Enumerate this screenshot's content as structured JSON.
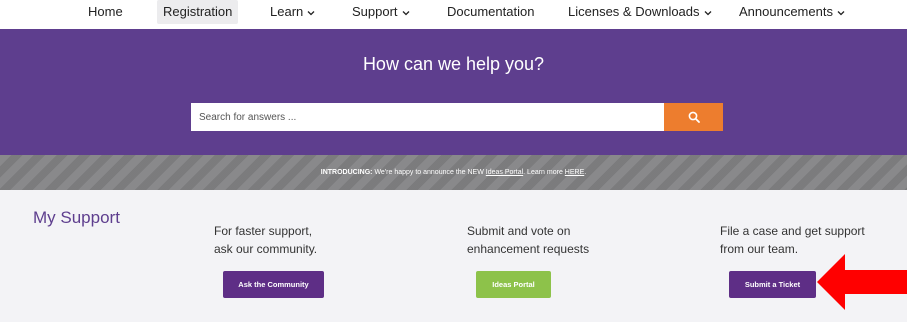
{
  "nav": {
    "items": [
      {
        "label": "Home",
        "dropdown": false,
        "active": false
      },
      {
        "label": "Registration",
        "dropdown": false,
        "active": true
      },
      {
        "label": "Learn",
        "dropdown": true,
        "active": false
      },
      {
        "label": "Support",
        "dropdown": true,
        "active": false
      },
      {
        "label": "Documentation",
        "dropdown": false,
        "active": false
      },
      {
        "label": "Licenses & Downloads",
        "dropdown": true,
        "active": false
      },
      {
        "label": "Announcements",
        "dropdown": true,
        "active": false
      }
    ]
  },
  "hero": {
    "title": "How can we help you?",
    "search_placeholder": "Search for answers ...",
    "search_icon": "search-icon"
  },
  "announcement": {
    "prefix": "INTRODUCING:",
    "text": "We're happy to announce the NEW",
    "link1": "Ideas Portal",
    "middle": ". Learn more",
    "link2": "HERE",
    "suffix": "."
  },
  "support": {
    "heading": "My Support",
    "community": {
      "line1": "For faster support,",
      "line2": "ask our community.",
      "button": "Ask the Community"
    },
    "ideas": {
      "line1": "Submit and vote on",
      "line2": "enhancement requests",
      "button": "Ideas Portal"
    },
    "ticket": {
      "line1": "File a case and get support",
      "line2": "from our team.",
      "button": "Submit a Ticket"
    }
  },
  "colors": {
    "brand_purple": "#5e3e8e",
    "button_purple": "#5e2e86",
    "search_orange": "#ed7d2e",
    "ideas_green": "#8dc24a",
    "arrow_red": "#ff0000"
  }
}
